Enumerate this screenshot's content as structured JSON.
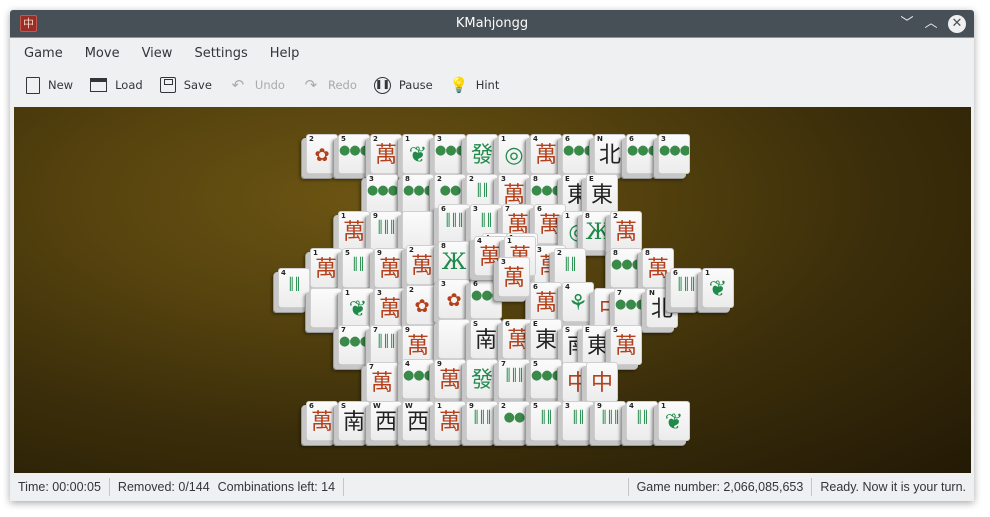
{
  "window": {
    "title": "KMahjongg",
    "app_icon": "mahjong-tile-icon",
    "controls": [
      "minimize",
      "maximize",
      "close"
    ]
  },
  "menubar": {
    "items": [
      "Game",
      "Move",
      "View",
      "Settings",
      "Help"
    ]
  },
  "toolbar": {
    "buttons": [
      {
        "label": "New",
        "icon": "new-document-icon",
        "enabled": true
      },
      {
        "label": "Load",
        "icon": "folder-icon",
        "enabled": true
      },
      {
        "label": "Save",
        "icon": "save-icon",
        "enabled": true
      },
      {
        "label": "Undo",
        "icon": "undo-icon",
        "enabled": false
      },
      {
        "label": "Redo",
        "icon": "redo-icon",
        "enabled": false
      },
      {
        "label": "Pause",
        "icon": "pause-icon",
        "enabled": true
      },
      {
        "label": "Hint",
        "icon": "lightbulb-icon",
        "enabled": true
      }
    ]
  },
  "status": {
    "time": "Time: 00:00:05",
    "removed": "Removed: 0/144",
    "combinations": "Combinations left: 14",
    "game_number": "Game number: 2,066,085,653",
    "message": "Ready. Now it is your turn."
  },
  "tiles": [
    {
      "n": "2",
      "g": "✿",
      "c": "flower"
    },
    {
      "n": "5",
      "g": "●●●",
      "c": "dots"
    },
    {
      "n": "2",
      "g": "萬",
      "c": "red"
    },
    {
      "n": "1",
      "g": "❦",
      "c": "green"
    },
    {
      "n": "3",
      "g": "●●●",
      "c": "dots"
    },
    {
      "n": "",
      "g": "發",
      "c": "green"
    },
    {
      "n": "1",
      "g": "◎",
      "c": "green"
    },
    {
      "n": "4",
      "g": "萬",
      "c": "red"
    },
    {
      "n": "6",
      "g": "●●●",
      "c": "dots"
    },
    {
      "n": "N",
      "g": "北",
      "c": "black"
    },
    {
      "n": "6",
      "g": "●●●",
      "c": "dots"
    },
    {
      "n": "3",
      "g": "●●●",
      "c": "dots"
    },
    {
      "n": "3",
      "g": "●●●",
      "c": "dots"
    },
    {
      "n": "8",
      "g": "●●●",
      "c": "dots"
    },
    {
      "n": "2",
      "g": "●●",
      "c": "dots"
    },
    {
      "n": "2",
      "g": "║║",
      "c": "bam"
    },
    {
      "n": "3",
      "g": "萬",
      "c": "red"
    },
    {
      "n": "8",
      "g": "●●●",
      "c": "dots"
    },
    {
      "n": "E",
      "g": "東",
      "c": "black"
    },
    {
      "n": "E",
      "g": "東",
      "c": "black"
    },
    {
      "n": "1",
      "g": "萬",
      "c": "red"
    },
    {
      "n": "9",
      "g": "║║║",
      "c": "bam"
    },
    {
      "n": "",
      "g": "",
      "c": "blank"
    },
    {
      "n": "6",
      "g": "║║║",
      "c": "bam"
    },
    {
      "n": "3",
      "g": "║║",
      "c": "bam"
    },
    {
      "n": "7",
      "g": "萬",
      "c": "red"
    },
    {
      "n": "6",
      "g": "萬",
      "c": "red"
    },
    {
      "n": "1",
      "g": "◎",
      "c": "green"
    },
    {
      "n": "8",
      "g": "Ж",
      "c": "green"
    },
    {
      "n": "2",
      "g": "萬",
      "c": "red"
    },
    {
      "n": "1",
      "g": "萬",
      "c": "red"
    },
    {
      "n": "5",
      "g": "║║",
      "c": "bam"
    },
    {
      "n": "9",
      "g": "萬",
      "c": "red"
    },
    {
      "n": "2",
      "g": "萬",
      "c": "red"
    },
    {
      "n": "8",
      "g": "Ж",
      "c": "green"
    },
    {
      "n": "4",
      "g": "萬",
      "c": "red"
    },
    {
      "n": "1",
      "g": "萬",
      "c": "red"
    },
    {
      "n": "3",
      "g": "萬",
      "c": "red"
    },
    {
      "n": "2",
      "g": "║║",
      "c": "bam"
    },
    {
      "n": "3",
      "g": "萬",
      "c": "red"
    },
    {
      "n": "8",
      "g": "●●●",
      "c": "dots"
    },
    {
      "n": "8",
      "g": "萬",
      "c": "red"
    },
    {
      "n": "4",
      "g": "║║",
      "c": "bam"
    },
    {
      "n": "",
      "g": "",
      "c": "blank"
    },
    {
      "n": "1",
      "g": "❦",
      "c": "green"
    },
    {
      "n": "3",
      "g": "萬",
      "c": "red"
    },
    {
      "n": "2",
      "g": "✿",
      "c": "flower"
    },
    {
      "n": "3",
      "g": "✿",
      "c": "flower"
    },
    {
      "n": "6",
      "g": "●●●",
      "c": "dots"
    },
    {
      "n": "6",
      "g": "萬",
      "c": "red"
    },
    {
      "n": "4",
      "g": "⚘",
      "c": "green"
    },
    {
      "n": "",
      "g": "中",
      "c": "red"
    },
    {
      "n": "7",
      "g": "●●●",
      "c": "dots"
    },
    {
      "n": "N",
      "g": "北",
      "c": "black"
    },
    {
      "n": "6",
      "g": "║║║",
      "c": "bam"
    },
    {
      "n": "1",
      "g": "❦",
      "c": "green"
    },
    {
      "n": "7",
      "g": "●●●",
      "c": "dots"
    },
    {
      "n": "7",
      "g": "║║║",
      "c": "bam"
    },
    {
      "n": "9",
      "g": "萬",
      "c": "red"
    },
    {
      "n": "",
      "g": "",
      "c": "blank"
    },
    {
      "n": "S",
      "g": "南",
      "c": "black"
    },
    {
      "n": "6",
      "g": "萬",
      "c": "red"
    },
    {
      "n": "E",
      "g": "東",
      "c": "black"
    },
    {
      "n": "S",
      "g": "南",
      "c": "black"
    },
    {
      "n": "E",
      "g": "東",
      "c": "black"
    },
    {
      "n": "5",
      "g": "萬",
      "c": "red"
    },
    {
      "n": "7",
      "g": "萬",
      "c": "red"
    },
    {
      "n": "4",
      "g": "●●●",
      "c": "dots"
    },
    {
      "n": "9",
      "g": "萬",
      "c": "red"
    },
    {
      "n": "",
      "g": "發",
      "c": "green"
    },
    {
      "n": "7",
      "g": "║║║",
      "c": "bam"
    },
    {
      "n": "5",
      "g": "●●●",
      "c": "dots"
    },
    {
      "n": "",
      "g": "中",
      "c": "red"
    },
    {
      "n": "",
      "g": "中",
      "c": "red"
    },
    {
      "n": "6",
      "g": "萬",
      "c": "red"
    },
    {
      "n": "S",
      "g": "南",
      "c": "black"
    },
    {
      "n": "W",
      "g": "西",
      "c": "black"
    },
    {
      "n": "W",
      "g": "西",
      "c": "black"
    },
    {
      "n": "1",
      "g": "萬",
      "c": "red"
    },
    {
      "n": "9",
      "g": "║║║",
      "c": "bam"
    },
    {
      "n": "2",
      "g": "●●",
      "c": "dots"
    },
    {
      "n": "5",
      "g": "║║",
      "c": "bam"
    },
    {
      "n": "3",
      "g": "║║",
      "c": "bam"
    },
    {
      "n": "9",
      "g": "║║║",
      "c": "bam"
    },
    {
      "n": "4",
      "g": "║║",
      "c": "bam"
    },
    {
      "n": "1",
      "g": "❦",
      "c": "green"
    },
    {
      "n": "4",
      "g": "萬",
      "c": "red"
    },
    {
      "n": "1",
      "g": "萬",
      "c": "red"
    },
    {
      "n": "3",
      "g": "萬",
      "c": "red"
    }
  ]
}
